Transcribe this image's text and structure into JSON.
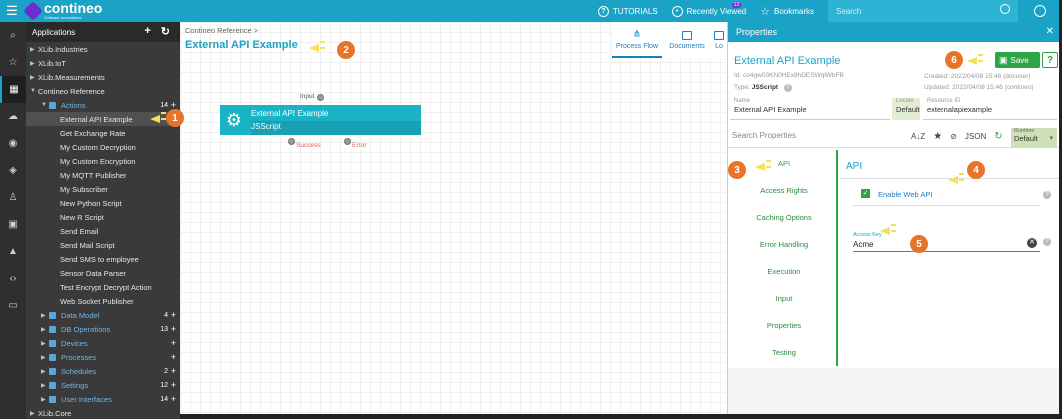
{
  "topbar": {
    "brand": "contineo",
    "brand_sub": "Software Innovations",
    "tutorials": "TUTORIALS",
    "recently_viewed": "Recently Viewed",
    "recent_count": "13",
    "bookmarks": "Bookmarks",
    "search_placeholder": "Search"
  },
  "rail_icons": [
    "search-icon",
    "star-icon",
    "apps-icon",
    "cloud-icon",
    "storage-icon",
    "shield-icon",
    "user-icon",
    "id-card-icon",
    "shapes-icon",
    "code-icon",
    "device-icon"
  ],
  "apps": {
    "title": "Applications",
    "tree": [
      {
        "label": "XLib.Industries",
        "level": 0
      },
      {
        "label": "XLib.IoT",
        "level": 0
      },
      {
        "label": "XLib.Measurements",
        "level": 0
      },
      {
        "label": "Contineo Reference",
        "level": 0,
        "expanded": true
      },
      {
        "label": "Actions",
        "level": 1,
        "count": "14",
        "plus": true,
        "expanded": true
      },
      {
        "label": "External API Example",
        "level": 2,
        "selected": true
      },
      {
        "label": "Get Exchange Rate",
        "level": 2
      },
      {
        "label": "My Custom Decryption",
        "level": 2
      },
      {
        "label": "My Custom Encryption",
        "level": 2
      },
      {
        "label": "My MQTT Publisher",
        "level": 2
      },
      {
        "label": "My Subscriber",
        "level": 2
      },
      {
        "label": "New Python Script",
        "level": 2
      },
      {
        "label": "New R Script",
        "level": 2
      },
      {
        "label": "Send Email",
        "level": 2
      },
      {
        "label": "Send Mail Script",
        "level": 2
      },
      {
        "label": "Send SMS to employee",
        "level": 2
      },
      {
        "label": "Sensor Data Parser",
        "level": 2
      },
      {
        "label": "Test Encrypt Decrypt Action",
        "level": 2
      },
      {
        "label": "Web Socket Publisher",
        "level": 2
      },
      {
        "label": "Data Model",
        "level": 1,
        "count": "4",
        "plus": true
      },
      {
        "label": "DB Operations",
        "level": 1,
        "count": "13",
        "plus": true
      },
      {
        "label": "Devices",
        "level": 1,
        "plus": true
      },
      {
        "label": "Processes",
        "level": 1,
        "plus": true
      },
      {
        "label": "Schedules",
        "level": 1,
        "count": "2",
        "plus": true
      },
      {
        "label": "Settings",
        "level": 1,
        "count": "12",
        "plus": true
      },
      {
        "label": "User Interfaces",
        "level": 1,
        "count": "14",
        "plus": true
      },
      {
        "label": "XLib.Core",
        "level": 0
      }
    ]
  },
  "canvas": {
    "breadcrumb": "Contineo Reference >",
    "title": "External API Example",
    "tabs": [
      "Process Flow",
      "Documents",
      "Lo"
    ],
    "node": {
      "title": "External API Example",
      "subtitle": "JSScript",
      "input_label": "Input",
      "success_label": "Success",
      "error_label": "Error"
    }
  },
  "properties": {
    "header": "Properties",
    "object_title": "External API Example",
    "id_label": "Id:",
    "id_value": "co4gw03KN0HEx8hDESWqlWbFB",
    "type_label": "Type:",
    "type_value": "JSScript",
    "created": "Created: 2022/04/08 15:46 (docuser)",
    "updated": "Updated: 2022/04/08 15:46 (contineo)",
    "save_label": "Save",
    "name_label": "Name",
    "name_value": "External API Example",
    "locale_label": "Locale",
    "locale_value": "Default",
    "resource_label": "Resource ID",
    "resource_value": "externalapiexample",
    "search_placeholder": "Search Properties",
    "json_label": "JSON",
    "runtime_label": "Runtime",
    "runtime_value": "Default",
    "sections": [
      "API",
      "Access Rights",
      "Caching Options",
      "Error Handling",
      "Execution",
      "Input",
      "Properties",
      "Testing"
    ],
    "content_title": "API",
    "enable_web_api": "Enable Web API",
    "access_key_label": "Access Key",
    "access_key_value": "Acme"
  },
  "callouts": [
    "1",
    "2",
    "3",
    "4",
    "5",
    "6"
  ]
}
